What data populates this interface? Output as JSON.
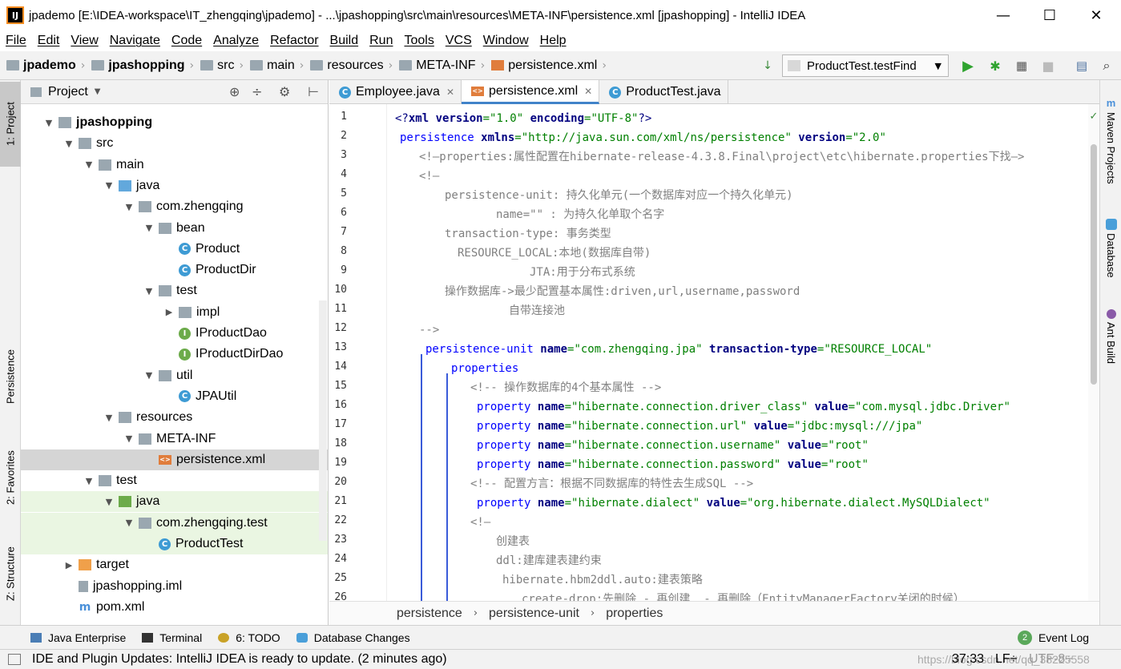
{
  "window": {
    "app_icon": "IJ",
    "title": "jpademo [E:\\IDEA-workspace\\IT_zhengqing\\jpademo] - ...\\jpashopping\\src\\main\\resources\\META-INF\\persistence.xml [jpashopping] - IntelliJ IDEA",
    "minimize": "—",
    "maximize": "☐",
    "close": "✕"
  },
  "menu": [
    "File",
    "Edit",
    "View",
    "Navigate",
    "Code",
    "Analyze",
    "Refactor",
    "Build",
    "Run",
    "Tools",
    "VCS",
    "Window",
    "Help"
  ],
  "navbar": {
    "crumbs": [
      "jpademo",
      "jpashopping",
      "src",
      "main",
      "resources",
      "META-INF",
      "persistence.xml"
    ],
    "run_config": "ProductTest.testFind"
  },
  "left_stripe": {
    "project": "1: Project",
    "persistence": "Persistence",
    "favorites": "2: Favorites",
    "structure": "Z: Structure"
  },
  "right_stripe": {
    "maven": "Maven Projects",
    "database": "Database",
    "ant": "Ant Build"
  },
  "project_panel": {
    "title": "Project",
    "tree": [
      {
        "label": "jpashopping",
        "depth": 1,
        "arrow": "down",
        "icon": "module",
        "bold": true
      },
      {
        "label": "src",
        "depth": 2,
        "arrow": "down",
        "icon": "folder"
      },
      {
        "label": "main",
        "depth": 3,
        "arrow": "down",
        "icon": "folder"
      },
      {
        "label": "java",
        "depth": 4,
        "arrow": "down",
        "icon": "src-folder"
      },
      {
        "label": "com.zhengqing",
        "depth": 5,
        "arrow": "down",
        "icon": "package"
      },
      {
        "label": "bean",
        "depth": 6,
        "arrow": "down",
        "icon": "package"
      },
      {
        "label": "Product",
        "depth": 7,
        "arrow": "",
        "icon": "class"
      },
      {
        "label": "ProductDir",
        "depth": 7,
        "arrow": "",
        "icon": "class"
      },
      {
        "label": "test",
        "depth": 6,
        "arrow": "down",
        "icon": "package"
      },
      {
        "label": "impl",
        "depth": 7,
        "arrow": "right",
        "icon": "package"
      },
      {
        "label": "IProductDao",
        "depth": 7,
        "arrow": "",
        "icon": "interface"
      },
      {
        "label": "IProductDirDao",
        "depth": 7,
        "arrow": "",
        "icon": "interface"
      },
      {
        "label": "util",
        "depth": 6,
        "arrow": "down",
        "icon": "package"
      },
      {
        "label": "JPAUtil",
        "depth": 7,
        "arrow": "",
        "icon": "class"
      },
      {
        "label": "resources",
        "depth": 4,
        "arrow": "down",
        "icon": "res-folder"
      },
      {
        "label": "META-INF",
        "depth": 5,
        "arrow": "down",
        "icon": "folder"
      },
      {
        "label": "persistence.xml",
        "depth": 6,
        "arrow": "",
        "icon": "xml",
        "selected": true
      },
      {
        "label": "test",
        "depth": 3,
        "arrow": "down",
        "icon": "folder"
      },
      {
        "label": "java",
        "depth": 4,
        "arrow": "down",
        "icon": "test-folder",
        "green": true
      },
      {
        "label": "com.zhengqing.test",
        "depth": 5,
        "arrow": "down",
        "icon": "package",
        "green": true
      },
      {
        "label": "ProductTest",
        "depth": 6,
        "arrow": "",
        "icon": "test-class",
        "green": true
      },
      {
        "label": "target",
        "depth": 2,
        "arrow": "right",
        "icon": "orange-folder"
      },
      {
        "label": "jpashopping.iml",
        "depth": 2,
        "arrow": "",
        "icon": "iml"
      },
      {
        "label": "pom.xml",
        "depth": 2,
        "arrow": "",
        "icon": "maven"
      }
    ]
  },
  "tabs": [
    {
      "label": "Employee.java",
      "icon": "class",
      "active": false
    },
    {
      "label": "persistence.xml",
      "icon": "xml",
      "active": true
    },
    {
      "label": "ProductTest.java",
      "icon": "test-class",
      "active": false
    }
  ],
  "code_lines": [
    "1",
    "2",
    "3",
    "4",
    "5",
    "6",
    "7",
    "8",
    "9",
    "10",
    "11",
    "12",
    "13",
    "14",
    "15",
    "16",
    "17",
    "18",
    "19",
    "20",
    "21",
    "22",
    "23",
    "24",
    "25",
    "26"
  ],
  "code": {
    "l1": [
      "<?",
      "xml",
      " version",
      "=\"1.0\"",
      " encoding",
      "=\"UTF-8\"",
      "?>"
    ],
    "l2": [
      "persistence",
      " xmlns",
      "=\"http://java.sun.com/xml/ns/persistence\"",
      " version",
      "=\"2.0\""
    ],
    "l3": "<!—properties:属性配置在hibernate-release-4.3.8.Final\\project\\etc\\hibernate.properties下找—>",
    "l4": "<!—",
    "l5": "persistence-unit: 持久化单元(一个数据库对应一个持久化单元)",
    "l6": "name=\"\" : 为持久化单取个名字",
    "l7": "transaction-type: 事务类型",
    "l8": "RESOURCE_LOCAL:本地(数据库自带)",
    "l9": "JTA:用于分布式系统",
    "l10": "操作数据库->最少配置基本属性:driven,url,username,password",
    "l11": "自带连接池",
    "l12": "-->",
    "l13": [
      "persistence-unit",
      " name",
      "=\"com.zhengqing.jpa\"",
      " transaction-type",
      "=\"RESOURCE_LOCAL\""
    ],
    "l14": "properties",
    "l15": "<!-- 操作数据库的4个基本属性 -->",
    "l16": [
      "property",
      " name",
      "=\"hibernate.connection.driver_class\"",
      " value",
      "=\"com.mysql.jdbc.Driver\""
    ],
    "l17": [
      "property",
      " name",
      "=\"hibernate.connection.url\"",
      " value",
      "=\"jdbc:mysql:///jpa\""
    ],
    "l18": [
      "property",
      " name",
      "=\"hibernate.connection.username\"",
      " value",
      "=\"root\""
    ],
    "l19": [
      "property",
      " name",
      "=\"hibernate.connection.password\"",
      " value",
      "=\"root\""
    ],
    "l20": "<!-- 配置方言：根据不同数据库的特性去生成SQL -->",
    "l21": [
      "property",
      " name",
      "=\"hibernate.dialect\"",
      " value",
      "=\"org.hibernate.dialect.MySQLDialect\""
    ],
    "l22": "<!—",
    "l23": "创建表",
    "l24": "ddl:建库建表建约束",
    "l25": "hibernate.hbm2ddl.auto:建表策略",
    "l26": "create-drop:先删除 - 再创建  - 再删除（EntityManagerFactory关闭的时候）"
  },
  "editor_breadcrumb": [
    "persistence",
    "persistence-unit",
    "properties"
  ],
  "bottom_tools": [
    "Java Enterprise",
    "Terminal",
    "6: TODO",
    "Database Changes"
  ],
  "event_log": {
    "count": "2",
    "label": "Event Log"
  },
  "status": {
    "message": "IDE and Plugin Updates: IntelliJ IDEA is ready to update. (2 minutes ago)",
    "position": "37:33",
    "line_sep": "LF÷",
    "encoding": "UTF-8÷",
    "watermark": "https://blog.csdn.net/qq_38225558"
  },
  "colors": {
    "accent": "#4083c9",
    "keyword": "#000080",
    "string": "#008000",
    "comment": "#808080",
    "selection": "#d5d5d5",
    "test_bg": "#eaf6e2"
  }
}
